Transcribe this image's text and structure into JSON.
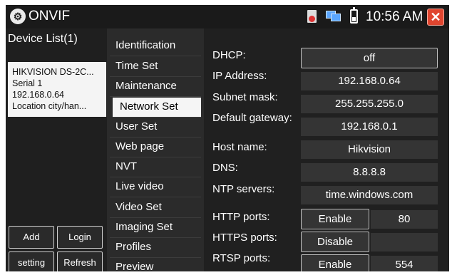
{
  "app": {
    "title": "ONVIF",
    "clock": "10:56 AM"
  },
  "device_list": {
    "header": "Device List(1)",
    "device": {
      "name": "HIKVISION DS-2C...",
      "serial": "Serial  1",
      "ip": "192.168.0.64",
      "location": "Location  city/han..."
    },
    "buttons": {
      "add": "Add",
      "login": "Login",
      "setting": "setting",
      "refresh": "Refresh"
    }
  },
  "menu": {
    "items": [
      "Identification",
      "Time Set",
      "Maintenance",
      "Network Set",
      "User Set",
      "Web page",
      "NVT",
      "Live video",
      "Video Set",
      "Imaging Set",
      "Profiles",
      "Preview"
    ],
    "active": "Network Set"
  },
  "network": {
    "dhcp_label": "DHCP:",
    "dhcp_value": "off",
    "ip_label": "IP Address:",
    "ip_value": "192.168.0.64",
    "subnet_label": "Subnet mask:",
    "subnet_value": "255.255.255.0",
    "gateway_label": "Default gateway:",
    "gateway_value": "192.168.0.1",
    "hostname_label": "Host name:",
    "hostname_value": "Hikvision",
    "dns_label": "DNS:",
    "dns_value": "8.8.8.8",
    "ntp_label": "NTP servers:",
    "ntp_value": "time.windows.com",
    "http_label": "HTTP ports:",
    "http_state": "Enable",
    "http_port": "80",
    "https_label": "HTTPS ports:",
    "https_state": "Disable",
    "https_port": "",
    "rtsp_label": "RTSP ports:",
    "rtsp_state": "Enable",
    "rtsp_port": "554"
  }
}
